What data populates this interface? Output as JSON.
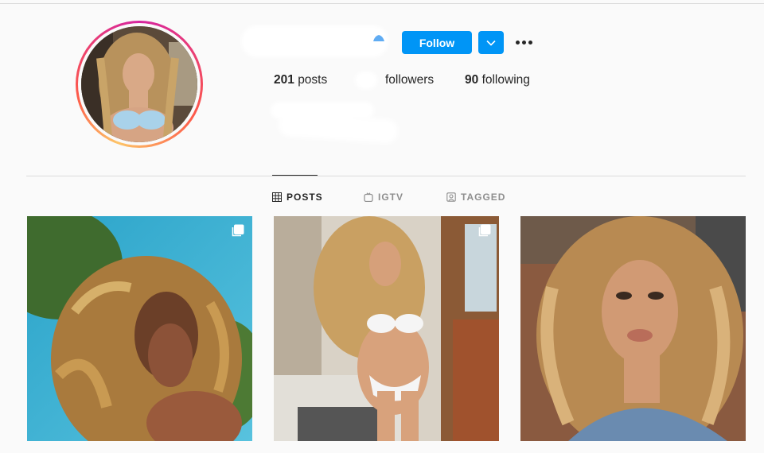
{
  "profile": {
    "follow_label": "Follow",
    "stats": {
      "posts_count": "201",
      "posts_label": "posts",
      "followers_label": "followers",
      "following_count": "90",
      "following_label": "following"
    }
  },
  "tabs": [
    {
      "label": "POSTS",
      "icon": "grid-icon",
      "active": true
    },
    {
      "label": "IGTV",
      "icon": "igtv-icon",
      "active": false
    },
    {
      "label": "TAGGED",
      "icon": "tagged-icon",
      "active": false
    }
  ],
  "posts": [
    {
      "icon": "multi-photo-icon",
      "has_multi": true
    },
    {
      "icon": "multi-photo-icon",
      "has_multi": true
    },
    {
      "has_multi": false
    }
  ],
  "colors": {
    "accent": "#0095f6",
    "text": "#262626",
    "muted": "#8e8e8e",
    "background": "#fafafa",
    "border": "#dbdbdb"
  }
}
